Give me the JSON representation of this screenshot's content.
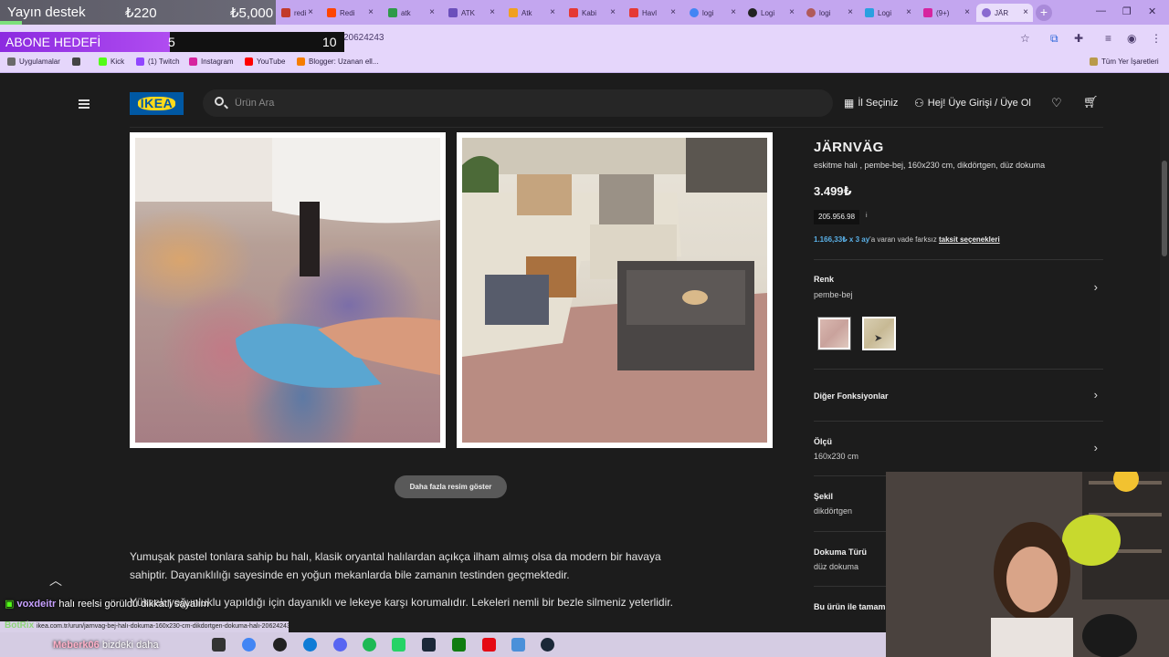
{
  "browser": {
    "tabs": [
      {
        "label": "redi",
        "favicon_color": "#c23a2b"
      },
      {
        "label": "Redi",
        "favicon_color": "#ff4500"
      },
      {
        "label": "atk",
        "favicon_color": "#2f9a4a"
      },
      {
        "label": "ATK",
        "favicon_color": "#6b4fbb"
      },
      {
        "label": "Atk",
        "favicon_color": "#f0a020"
      },
      {
        "label": "Kabi",
        "favicon_color": "#e53935"
      },
      {
        "label": "Havl",
        "favicon_color": "#e53935"
      },
      {
        "label": "logi",
        "favicon_color": "#4285f4"
      },
      {
        "label": "Logi",
        "favicon_color": "#222222"
      },
      {
        "label": "logi",
        "favicon_color": "#b05a5a"
      },
      {
        "label": "Logi",
        "favicon_color": "#2aa0e0"
      },
      {
        "label": "(9+)",
        "favicon_color": "#d6249f"
      },
      {
        "label": "JÄR",
        "favicon_color": "#8a6ad0"
      }
    ],
    "url_fragment": "20624243",
    "bookmarks": [
      "Uygulamalar",
      "Kick",
      "(1) Twitch",
      "Instagram",
      "YouTube",
      "Blogger: Uzanan ell..."
    ],
    "all_bookmarks": "Tüm Yer İşaretleri"
  },
  "overlay": {
    "donation_label": "Yayın destek",
    "donation_current": "₺220",
    "donation_goal": "₺5,000",
    "sub_goal_label": "ABONE HEDEFİ",
    "sub_current": "5",
    "sub_target": "10",
    "chat": [
      {
        "user": "voxdeitr",
        "message": "halı reelsi görüldü dikkatli sayalım"
      },
      {
        "user": "Meberk06",
        "message": "bizdeki daha"
      }
    ],
    "bot_name": "BotRix",
    "status_url": "ikea.com.tr/urun/jarnvag-bej-halı-dokuma-160x230-cm-dikdortgen-dokuma-halı-20624243"
  },
  "ikea": {
    "logo": "IKEA",
    "search_placeholder": "Ürün Ara",
    "store_select": "İl Seçiniz",
    "login": "Hej! Üye Girişi / Üye Ol",
    "more_images_button": "Daha fazla resim göster",
    "description_1": "Yumuşak pastel tonlara sahip bu halı, klasik oryantal halılardan açıkça ilham almış olsa da modern bir havaya sahiptir. Dayanıklılığı sayesinde en yoğun mekanlarda bile zamanın testinden geçmektedir.",
    "description_2": "Yüksek yoğunluklu yapıldığı için dayanıklı ve lekeye karşı korumalıdır. Lekeleri nemli bir bezle silmeniz yeterlidir.",
    "product": {
      "name": "JÄRNVÄG",
      "subtitle": "eskitme halı , pembe-bej, 160x230 cm, dikdörtgen, düz dokuma",
      "price": "3.499₺",
      "price_box": "205.956.98",
      "info_icon": "i",
      "installment_amount": "1.166,33₺ x 3 ay",
      "installment_text": "'a varan vade farksız",
      "installment_link": "taksit seçenekleri",
      "color_label": "Renk",
      "color_value": "pembe-bej",
      "other_functions": "Diğer Fonksiyonlar",
      "size_label": "Ölçü",
      "size_value": "160x230 cm",
      "shape_label": "Şekil",
      "shape_value": "dikdörtgen",
      "weave_label": "Dokuma Türü",
      "weave_value": "düz dokuma",
      "more_label": "Bu ürün ile tamamla"
    }
  },
  "colors": {
    "page_bg": "#1c1c1c",
    "browser_accent": "#c3a6ef",
    "ikea_blue": "#0058a3",
    "ikea_yellow": "#ffda1a",
    "link_blue": "#5ab1e8"
  }
}
